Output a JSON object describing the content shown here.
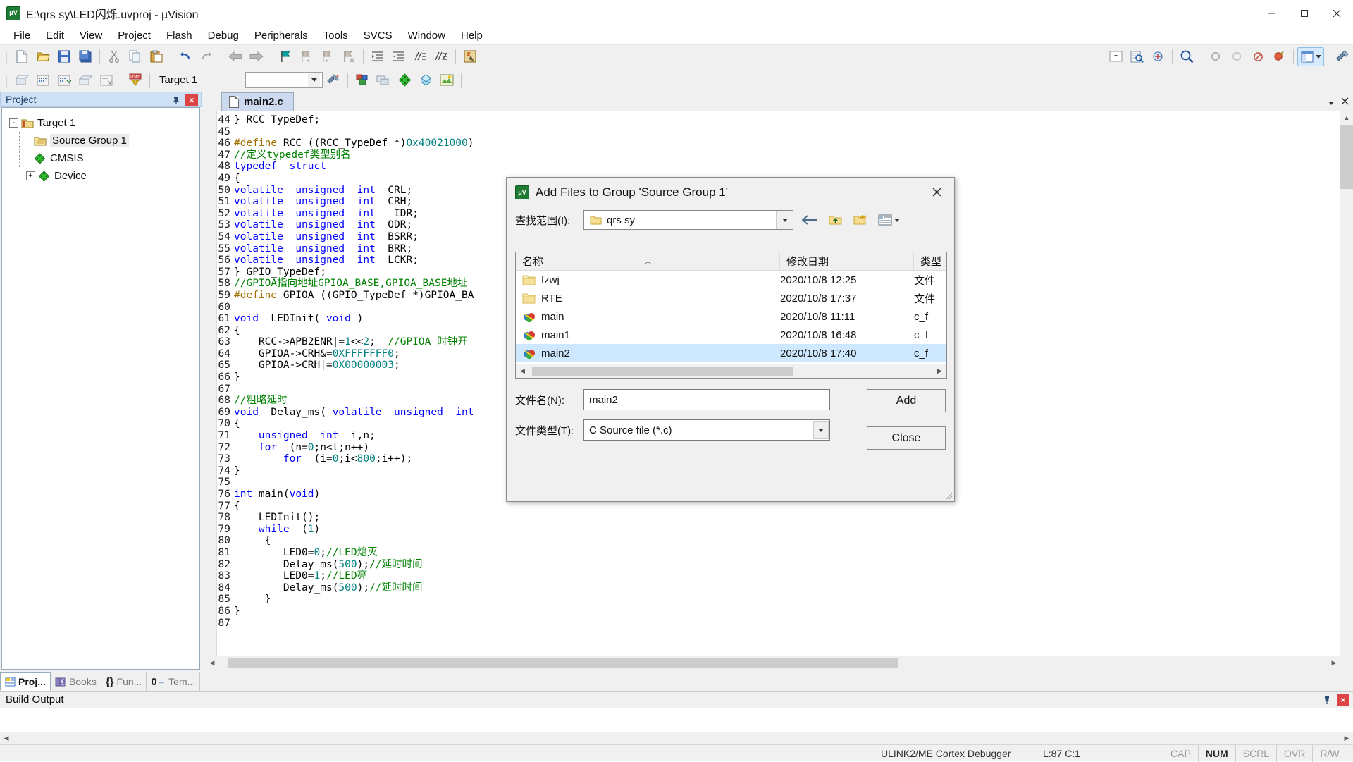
{
  "window": {
    "title": "E:\\qrs sy\\LED闪烁.uvproj - µVision",
    "app_icon": "uvision-icon",
    "minimize": "minimize-icon",
    "maximize": "maximize-icon",
    "close": "close-icon"
  },
  "menubar": {
    "items": [
      "File",
      "Edit",
      "View",
      "Project",
      "Flash",
      "Debug",
      "Peripherals",
      "Tools",
      "SVCS",
      "Window",
      "Help"
    ]
  },
  "toolbar2": {
    "target_label": "Target 1"
  },
  "project_panel": {
    "title": "Project",
    "pin": "pin-icon",
    "close": "close-icon",
    "tree": [
      {
        "label": "Target 1",
        "icon": "target-folder-icon",
        "expander": "-",
        "depth": 0
      },
      {
        "label": "Source Group 1",
        "icon": "folder-icon",
        "expander": "",
        "depth": 1
      },
      {
        "label": "CMSIS",
        "icon": "component-icon",
        "expander": "",
        "depth": 1
      },
      {
        "label": "Device",
        "icon": "component-icon",
        "expander": "+",
        "depth": 1
      }
    ],
    "tabs": [
      {
        "label": "Proj...",
        "icon": "project-icon",
        "active": true
      },
      {
        "label": "Books",
        "icon": "books-icon",
        "active": false
      },
      {
        "label": "Fun...",
        "icon": "functions-icon",
        "active": false
      },
      {
        "label": "Tem...",
        "icon": "templates-icon",
        "active": false
      }
    ]
  },
  "editor": {
    "tab_label": "main2.c",
    "tab_icon": "file-icon",
    "lines": [
      {
        "n": 44,
        "tokens": [
          {
            "t": "} RCC_TypeDef;",
            "c": "pl"
          }
        ]
      },
      {
        "n": 45,
        "tokens": []
      },
      {
        "n": 46,
        "tokens": [
          {
            "t": "#define",
            "c": "pp"
          },
          {
            "t": " RCC ((RCC_TypeDef *)",
            "c": "pl"
          },
          {
            "t": "0x40021000",
            "c": "num"
          },
          {
            "t": ")",
            "c": "pl"
          }
        ]
      },
      {
        "n": 47,
        "tokens": [
          {
            "t": "//定义typedef类型别名",
            "c": "cm"
          }
        ]
      },
      {
        "n": 48,
        "tokens": [
          {
            "t": "typedef",
            "c": "k"
          },
          {
            "t": "  struct",
            "c": "k"
          }
        ]
      },
      {
        "n": 49,
        "tokens": [
          {
            "t": "{",
            "c": "pl"
          }
        ]
      },
      {
        "n": 50,
        "tokens": [
          {
            "t": "volatile",
            "c": "k"
          },
          {
            "t": "  ",
            "c": "pl"
          },
          {
            "t": "unsigned",
            "c": "k"
          },
          {
            "t": "  ",
            "c": "pl"
          },
          {
            "t": "int",
            "c": "k"
          },
          {
            "t": "  CRL;",
            "c": "pl"
          }
        ]
      },
      {
        "n": 51,
        "tokens": [
          {
            "t": "volatile",
            "c": "k"
          },
          {
            "t": "  ",
            "c": "pl"
          },
          {
            "t": "unsigned",
            "c": "k"
          },
          {
            "t": "  ",
            "c": "pl"
          },
          {
            "t": "int",
            "c": "k"
          },
          {
            "t": "  CRH;",
            "c": "pl"
          }
        ]
      },
      {
        "n": 52,
        "tokens": [
          {
            "t": "volatile",
            "c": "k"
          },
          {
            "t": "  ",
            "c": "pl"
          },
          {
            "t": "unsigned",
            "c": "k"
          },
          {
            "t": "  ",
            "c": "pl"
          },
          {
            "t": "int",
            "c": "k"
          },
          {
            "t": "   IDR;",
            "c": "pl"
          }
        ]
      },
      {
        "n": 53,
        "tokens": [
          {
            "t": "volatile",
            "c": "k"
          },
          {
            "t": "  ",
            "c": "pl"
          },
          {
            "t": "unsigned",
            "c": "k"
          },
          {
            "t": "  ",
            "c": "pl"
          },
          {
            "t": "int",
            "c": "k"
          },
          {
            "t": "  ODR;",
            "c": "pl"
          }
        ]
      },
      {
        "n": 54,
        "tokens": [
          {
            "t": "volatile",
            "c": "k"
          },
          {
            "t": "  ",
            "c": "pl"
          },
          {
            "t": "unsigned",
            "c": "k"
          },
          {
            "t": "  ",
            "c": "pl"
          },
          {
            "t": "int",
            "c": "k"
          },
          {
            "t": "  BSRR;",
            "c": "pl"
          }
        ]
      },
      {
        "n": 55,
        "tokens": [
          {
            "t": "volatile",
            "c": "k"
          },
          {
            "t": "  ",
            "c": "pl"
          },
          {
            "t": "unsigned",
            "c": "k"
          },
          {
            "t": "  ",
            "c": "pl"
          },
          {
            "t": "int",
            "c": "k"
          },
          {
            "t": "  BRR;",
            "c": "pl"
          }
        ]
      },
      {
        "n": 56,
        "tokens": [
          {
            "t": "volatile",
            "c": "k"
          },
          {
            "t": "  ",
            "c": "pl"
          },
          {
            "t": "unsigned",
            "c": "k"
          },
          {
            "t": "  ",
            "c": "pl"
          },
          {
            "t": "int",
            "c": "k"
          },
          {
            "t": "  LCKR;",
            "c": "pl"
          }
        ]
      },
      {
        "n": 57,
        "tokens": [
          {
            "t": "} GPIO_TypeDef;",
            "c": "pl"
          }
        ]
      },
      {
        "n": 58,
        "tokens": [
          {
            "t": "//GPIOA指向地址GPIOA_BASE,GPIOA_BASE地址",
            "c": "cm"
          }
        ]
      },
      {
        "n": 59,
        "tokens": [
          {
            "t": "#define",
            "c": "pp"
          },
          {
            "t": " GPIOA ((GPIO_TypeDef *)GPIOA_BA",
            "c": "pl"
          }
        ]
      },
      {
        "n": 60,
        "tokens": []
      },
      {
        "n": 61,
        "tokens": [
          {
            "t": "void",
            "c": "k"
          },
          {
            "t": "  LEDInit( ",
            "c": "pl"
          },
          {
            "t": "void",
            "c": "k"
          },
          {
            "t": " )",
            "c": "pl"
          }
        ]
      },
      {
        "n": 62,
        "tokens": [
          {
            "t": "{",
            "c": "pl"
          }
        ]
      },
      {
        "n": 63,
        "tokens": [
          {
            "t": "    RCC->APB2ENR|=",
            "c": "pl"
          },
          {
            "t": "1",
            "c": "num"
          },
          {
            "t": "<<",
            "c": "pl"
          },
          {
            "t": "2",
            "c": "num"
          },
          {
            "t": ";  ",
            "c": "pl"
          },
          {
            "t": "//GPIOA 时钟开",
            "c": "cm"
          }
        ]
      },
      {
        "n": 64,
        "tokens": [
          {
            "t": "    GPIOA->CRH&=",
            "c": "pl"
          },
          {
            "t": "0XFFFFFFF0",
            "c": "num"
          },
          {
            "t": ";",
            "c": "pl"
          }
        ]
      },
      {
        "n": 65,
        "tokens": [
          {
            "t": "    GPIOA->CRH|=",
            "c": "pl"
          },
          {
            "t": "0X00000003",
            "c": "num"
          },
          {
            "t": ";",
            "c": "pl"
          }
        ]
      },
      {
        "n": 66,
        "tokens": [
          {
            "t": "}",
            "c": "pl"
          }
        ]
      },
      {
        "n": 67,
        "tokens": []
      },
      {
        "n": 68,
        "tokens": [
          {
            "t": "//粗略延时",
            "c": "cm"
          }
        ]
      },
      {
        "n": 69,
        "tokens": [
          {
            "t": "void",
            "c": "k"
          },
          {
            "t": "  Delay_ms( ",
            "c": "pl"
          },
          {
            "t": "volatile",
            "c": "k"
          },
          {
            "t": "  ",
            "c": "pl"
          },
          {
            "t": "unsigned",
            "c": "k"
          },
          {
            "t": "  ",
            "c": "pl"
          },
          {
            "t": "int",
            "c": "k"
          }
        ]
      },
      {
        "n": 70,
        "tokens": [
          {
            "t": "{",
            "c": "pl"
          }
        ]
      },
      {
        "n": 71,
        "tokens": [
          {
            "t": "    ",
            "c": "pl"
          },
          {
            "t": "unsigned",
            "c": "k"
          },
          {
            "t": "  ",
            "c": "pl"
          },
          {
            "t": "int",
            "c": "k"
          },
          {
            "t": "  i,n;",
            "c": "pl"
          }
        ]
      },
      {
        "n": 72,
        "tokens": [
          {
            "t": "    ",
            "c": "pl"
          },
          {
            "t": "for",
            "c": "k"
          },
          {
            "t": "  (n=",
            "c": "pl"
          },
          {
            "t": "0",
            "c": "num"
          },
          {
            "t": ";n<t;n++)",
            "c": "pl"
          }
        ]
      },
      {
        "n": 73,
        "tokens": [
          {
            "t": "        ",
            "c": "pl"
          },
          {
            "t": "for",
            "c": "k"
          },
          {
            "t": "  (i=",
            "c": "pl"
          },
          {
            "t": "0",
            "c": "num"
          },
          {
            "t": ";i<",
            "c": "pl"
          },
          {
            "t": "800",
            "c": "num"
          },
          {
            "t": ";i++);",
            "c": "pl"
          }
        ]
      },
      {
        "n": 74,
        "tokens": [
          {
            "t": "}",
            "c": "pl"
          }
        ]
      },
      {
        "n": 75,
        "tokens": []
      },
      {
        "n": 76,
        "tokens": [
          {
            "t": "int",
            "c": "k"
          },
          {
            "t": " main(",
            "c": "pl"
          },
          {
            "t": "void",
            "c": "k"
          },
          {
            "t": ")",
            "c": "pl"
          }
        ]
      },
      {
        "n": 77,
        "tokens": [
          {
            "t": "{",
            "c": "pl"
          }
        ]
      },
      {
        "n": 78,
        "tokens": [
          {
            "t": "    LEDInit();",
            "c": "pl"
          }
        ]
      },
      {
        "n": 79,
        "tokens": [
          {
            "t": "    ",
            "c": "pl"
          },
          {
            "t": "while",
            "c": "k"
          },
          {
            "t": "  (",
            "c": "pl"
          },
          {
            "t": "1",
            "c": "num"
          },
          {
            "t": ")",
            "c": "pl"
          }
        ]
      },
      {
        "n": 80,
        "tokens": [
          {
            "t": "     {",
            "c": "pl"
          }
        ]
      },
      {
        "n": 81,
        "tokens": [
          {
            "t": "        LED0=",
            "c": "pl"
          },
          {
            "t": "0",
            "c": "num"
          },
          {
            "t": ";",
            "c": "pl"
          },
          {
            "t": "//LED熄灭",
            "c": "cm"
          }
        ]
      },
      {
        "n": 82,
        "tokens": [
          {
            "t": "        Delay_ms(",
            "c": "pl"
          },
          {
            "t": "500",
            "c": "num"
          },
          {
            "t": ");",
            "c": "pl"
          },
          {
            "t": "//延时时间",
            "c": "cm"
          }
        ]
      },
      {
        "n": 83,
        "tokens": [
          {
            "t": "        LED0=",
            "c": "pl"
          },
          {
            "t": "1",
            "c": "num"
          },
          {
            "t": ";",
            "c": "pl"
          },
          {
            "t": "//LED亮",
            "c": "cm"
          }
        ]
      },
      {
        "n": 84,
        "tokens": [
          {
            "t": "        Delay_ms(",
            "c": "pl"
          },
          {
            "t": "500",
            "c": "num"
          },
          {
            "t": ");",
            "c": "pl"
          },
          {
            "t": "//延时时间",
            "c": "cm"
          }
        ]
      },
      {
        "n": 85,
        "tokens": [
          {
            "t": "     }",
            "c": "pl"
          }
        ]
      },
      {
        "n": 86,
        "tokens": [
          {
            "t": "}",
            "c": "pl"
          }
        ]
      },
      {
        "n": 87,
        "tokens": []
      }
    ]
  },
  "build_output": {
    "title": "Build Output",
    "content": ""
  },
  "statusbar": {
    "debugger": "ULINK2/ME Cortex Debugger",
    "position": "L:87 C:1",
    "indicators": [
      {
        "label": "CAP",
        "on": false
      },
      {
        "label": "NUM",
        "on": true
      },
      {
        "label": "SCRL",
        "on": false
      },
      {
        "label": "OVR",
        "on": false
      },
      {
        "label": "R/W",
        "on": false
      }
    ]
  },
  "dialog": {
    "title": "Add Files to Group 'Source Group 1'",
    "icon": "uvision-icon",
    "close": "close-icon",
    "lookin_label": "查找范围(I):",
    "lookin_value": "qrs sy",
    "nav": [
      "back-icon",
      "up-folder-icon",
      "new-folder-icon",
      "view-mode-icon"
    ],
    "columns": [
      "名称",
      "修改日期",
      "类型"
    ],
    "files": [
      {
        "name": "fzwj",
        "date": "2020/10/8 12:25",
        "type": "文件",
        "icon": "folder-icon",
        "selected": false
      },
      {
        "name": "RTE",
        "date": "2020/10/8 17:37",
        "type": "文件",
        "icon": "folder-icon",
        "selected": false
      },
      {
        "name": "main",
        "date": "2020/10/8 11:11",
        "type": "c_f",
        "icon": "c-source-icon",
        "selected": false
      },
      {
        "name": "main1",
        "date": "2020/10/8 16:48",
        "type": "c_f",
        "icon": "c-source-icon",
        "selected": false
      },
      {
        "name": "main2",
        "date": "2020/10/8 17:40",
        "type": "c_f",
        "icon": "c-source-icon",
        "selected": true
      }
    ],
    "filename_label": "文件名(N):",
    "filename_value": "main2",
    "filetype_label": "文件类型(T):",
    "filetype_value": "C Source file (*.c)",
    "add_button": "Add",
    "close_button": "Close"
  },
  "colors": {
    "accent": "#cde8ff",
    "panel_header": "#cfe2f5",
    "keyword": "#0000ff",
    "comment": "#008000",
    "number": "#008080",
    "preproc": "#a07000",
    "close_red": "#e81123"
  }
}
